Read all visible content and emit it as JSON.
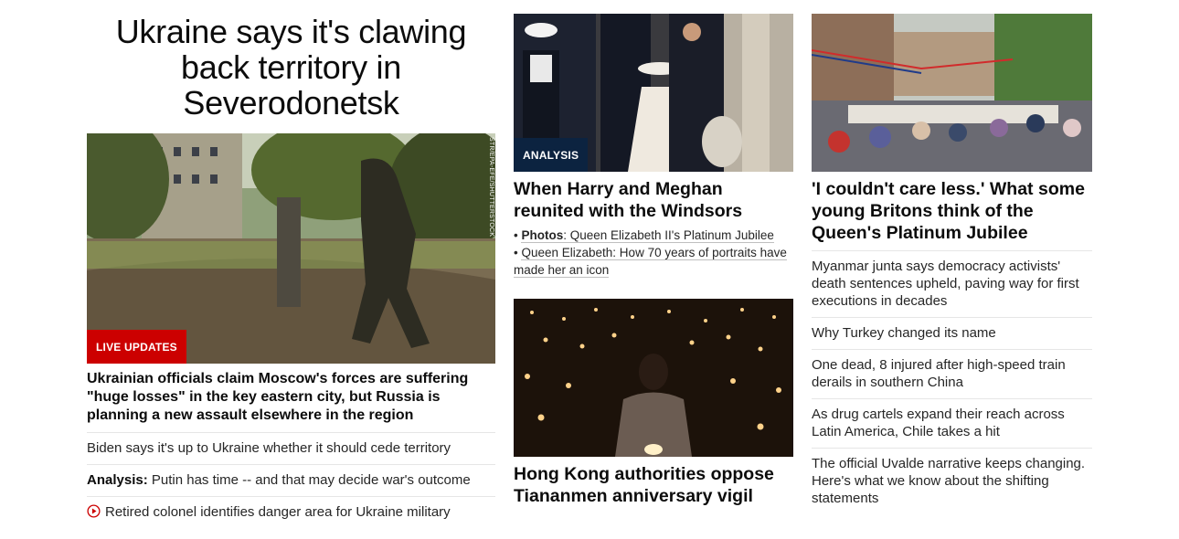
{
  "left": {
    "headline": "Ukraine says it's clawing back territory in Severodonetsk",
    "photo_credit": "STR/EPA-EFE/SHUTTERSTOCK",
    "badge": "LIVE UPDATES",
    "lead": "Ukrainian officials claim Moscow's forces are suffering \"huge losses\" in the key eastern city, but Russia is planning a new assault elsewhere in the region",
    "items": [
      {
        "prefix": "",
        "text": "Biden says it's up to Ukraine whether it should cede territory"
      },
      {
        "prefix": "Analysis:",
        "text": " Putin has time -- and that may decide war's outcome"
      },
      {
        "prefix": "",
        "text": "Retired colonel identifies danger area for Ukraine military",
        "icon": "play-icon"
      }
    ]
  },
  "middle": {
    "card1": {
      "badge": "ANALYSIS",
      "title": "When Harry and Meghan reunited with the Windsors",
      "sublinks": [
        {
          "bold": "Photos",
          "text": ": Queen Elizabeth II's Platinum Jubilee"
        },
        {
          "bold": "",
          "text": "Queen Elizabeth: How 70 years of portraits have made her an icon"
        }
      ]
    },
    "card2": {
      "title": "Hong Kong authorities oppose Tiananmen anniversary vigil"
    }
  },
  "right": {
    "card": {
      "title": "'I couldn't care less.' What some young Britons think of the Queen's Platinum Jubilee"
    },
    "items": [
      "Myanmar junta says democracy activists' death sentences upheld, paving way for first executions in decades",
      "Why Turkey changed its name",
      "One dead, 8 injured after high-speed train derails in southern China",
      "As drug cartels expand their reach across Latin America, Chile takes a hit",
      "The official Uvalde narrative keeps changing. Here's what we know about the shifting statements"
    ]
  },
  "colors": {
    "live_badge": "#cc0000",
    "analysis_badge": "#0c2340",
    "text": "#0c0c0c",
    "divider": "#e6e6e6"
  }
}
